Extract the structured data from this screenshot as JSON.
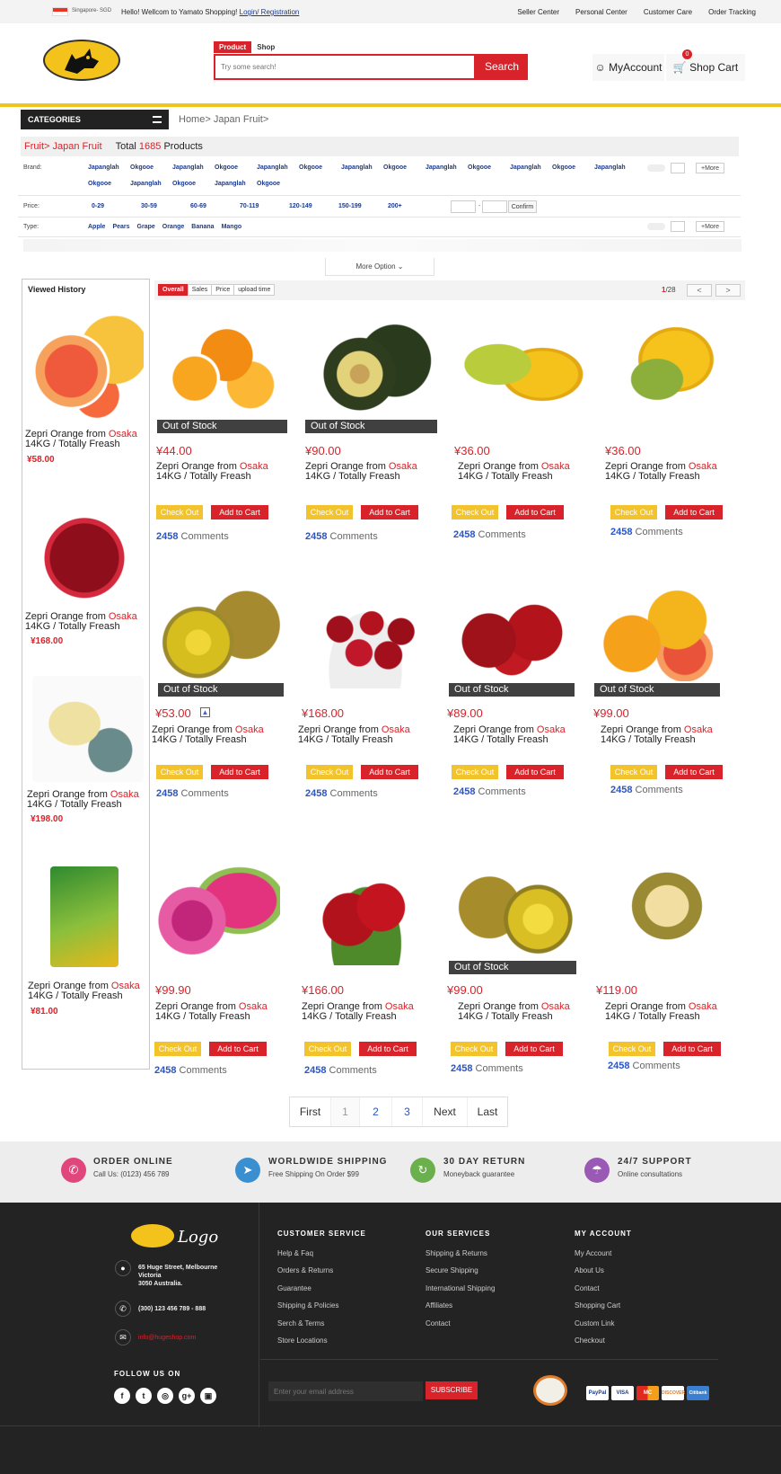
{
  "topbar": {
    "region": "Singapore- SGD",
    "hello": "Hello! Wellcom to Yamato Shopping!",
    "login": "Login/ Registration",
    "links": [
      "Seller Center",
      "Personal Center",
      "Customer Care",
      "Order Tracking"
    ]
  },
  "header": {
    "search_tabs": [
      "Product",
      "Shop"
    ],
    "search_placeholder": "Try some search!",
    "search_button": "Search",
    "my_account": "MyAccount",
    "shop_cart": "Shop Cart",
    "cart_count": "0"
  },
  "categories": {
    "label": "CATEGORIES",
    "breadcrumb": "Home> Japan Fruit>"
  },
  "filters": {
    "path": "Fruit> Japan Fruit",
    "total_prefix": "Total",
    "total_count": "1685",
    "total_suffix": "Products",
    "brand_label": "Brand:",
    "brands": [
      "Japanglah",
      "Okgooe",
      "Japanglah",
      "Okgooe",
      "Japanglah",
      "Okgooe",
      "Japanglah",
      "Okgooe",
      "Japanglah",
      "Okgooe",
      "Japanglah",
      "Okgooe",
      "Japanglah",
      "Okgooe",
      "Japanglah",
      "Okgooe",
      "Japanglah",
      "Okgooe"
    ],
    "price_label": "Price:",
    "prices": [
      "0-29",
      "30-59",
      "60-69",
      "70-119",
      "120-149",
      "150-199",
      "200+"
    ],
    "confirm": "Confirm",
    "type_label": "Type:",
    "types": [
      "Apple",
      "Pears",
      "Grape",
      "Orange",
      "Banana",
      "Mango"
    ],
    "more": "More",
    "more_option": "More Option"
  },
  "history": {
    "title": "Viewed History",
    "items": [
      {
        "name_a": "Zepri Orange from ",
        "name_b": "Osaka",
        "name_c": "14KG / Totally Freash",
        "price": "¥58.00"
      },
      {
        "name_a": "Zepri Orange from ",
        "name_b": "Osaka",
        "name_c": "14KG / Totally Freash",
        "price": "¥168.00"
      },
      {
        "name_a": "Zepri Orange from ",
        "name_b": "Osaka",
        "name_c": "14KG / Totally Freash",
        "price": "¥198.00"
      },
      {
        "name_a": "Zepri Orange from ",
        "name_b": "Osaka",
        "name_c": "14KG / Totally Freash",
        "price": "¥81.00"
      }
    ]
  },
  "sort": {
    "tabs": [
      "Overall",
      "Sales",
      "Price",
      "upload time"
    ],
    "page_current": "1",
    "page_total": "/28"
  },
  "products": {
    "name_a": "Zepri Orange from ",
    "name_b": "Osaka",
    "name_c": "14KG / Totally Freash",
    "check_out": "Check Out",
    "add_to_cart": "Add to Cart",
    "comments_count": "2458",
    "comments_label": "Comments",
    "out_of_stock": "Out of Stock",
    "prices": [
      "¥44.00",
      "¥90.00",
      "¥36.00",
      "¥36.00",
      "¥53.00",
      "¥168.00",
      "¥89.00",
      "¥99.00",
      "¥99.90",
      "¥166.00",
      "¥99.00",
      "¥119.00"
    ]
  },
  "pagination": [
    "First",
    "1",
    "2",
    "3",
    "Next",
    "Last"
  ],
  "services": [
    {
      "title": "ORDER ONLINE",
      "sub": "Call Us: (0123) 456 789",
      "color": "#e0457b"
    },
    {
      "title": "WORLDWIDE SHIPPING",
      "sub": "Free Shipping On Order $99",
      "color": "#3a8fd0"
    },
    {
      "title": "30 DAY RETURN",
      "sub": "Moneyback guarantee",
      "color": "#6ab04c"
    },
    {
      "title": "24/7 SUPPORT",
      "sub": "Online consultations",
      "color": "#9b59b6"
    }
  ],
  "footer": {
    "logo_text": "Logo",
    "address": [
      "65 Huge Street, Melbourne",
      "Victoria",
      "3050 Australia."
    ],
    "phone": "(300) 123 456 789 - 888",
    "email": "info@hugeshop.com",
    "follow": "FOLLOW US ON",
    "customer_service": {
      "title": "CUSTOMER SERVICE",
      "links": [
        "Help & Faq",
        "Orders & Returns",
        "Guarantee",
        "Shipping & Policies",
        "Serch & Terms",
        "Store Locations"
      ]
    },
    "our_services": {
      "title": "OUR SERVICES",
      "links": [
        "Shipping & Returns",
        "Secure Shipping",
        "International Shipping",
        "Affiliates",
        "Contact"
      ]
    },
    "my_account": {
      "title": "MY ACCOUNT",
      "links": [
        "My Account",
        "About Us",
        "Contact",
        "Shopping Cart",
        "Custom Link",
        "Checkout"
      ]
    },
    "email_placeholder": "Enter your email address",
    "subscribe": "SUBSCRIBE",
    "cards": [
      "PayPal",
      "VISA",
      "MC",
      "DISCOVER",
      "Citibank"
    ]
  }
}
